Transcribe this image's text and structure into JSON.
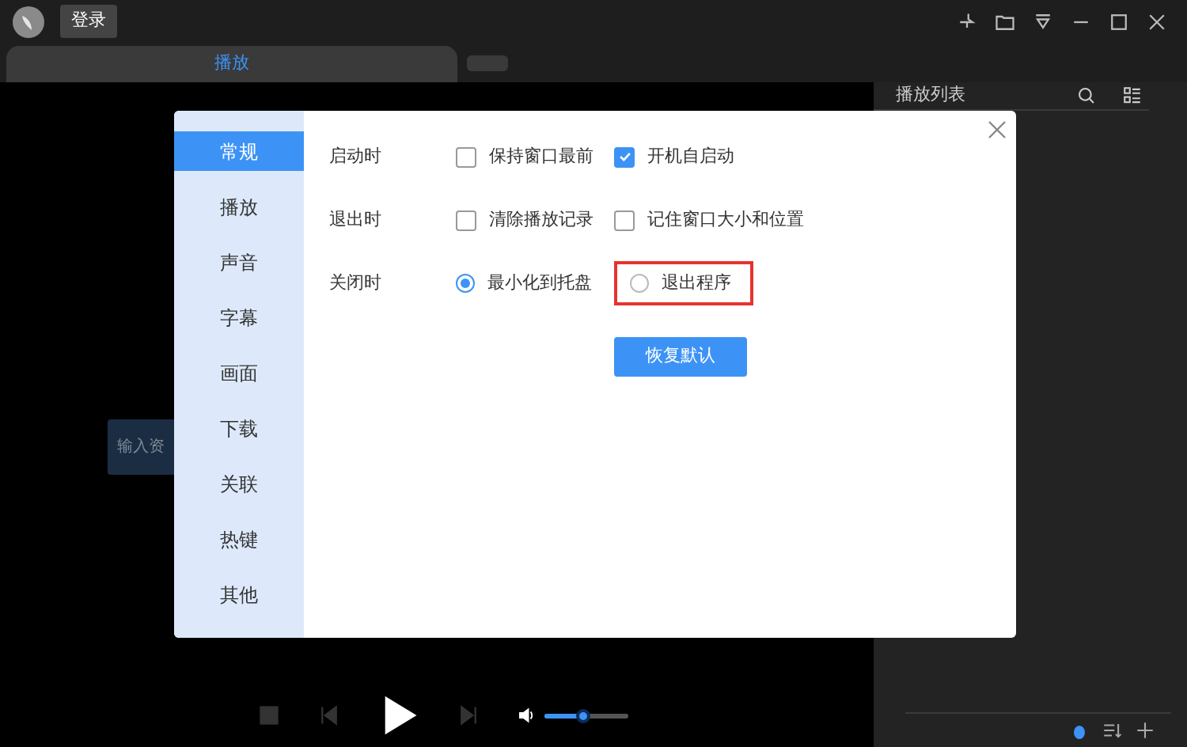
{
  "titlebar": {
    "login_button": "登录"
  },
  "tabs": [
    {
      "kind": "tab",
      "label": "播放",
      "selected": true
    },
    {
      "kind": "new",
      "selected": false
    }
  ],
  "playlist": {
    "title": "播放列表"
  },
  "video": {
    "input_hint": "输入资"
  },
  "player": {
    "volume": {
      "level": 0.45
    }
  },
  "settings": {
    "nav": [
      {
        "label": "常规",
        "selected": true
      },
      {
        "label": "播放",
        "selected": false
      },
      {
        "label": "声音",
        "selected": false
      },
      {
        "label": "字幕",
        "selected": false
      },
      {
        "label": "画面",
        "selected": false
      },
      {
        "label": "下载",
        "selected": false
      },
      {
        "label": "关联",
        "selected": false
      },
      {
        "label": "热键",
        "selected": false
      },
      {
        "label": "其他",
        "selected": false
      }
    ],
    "rows": [
      {
        "label": "启动时",
        "kind": "checkbox",
        "options": [
          {
            "label": "保持窗口最前",
            "checked": false
          },
          {
            "label": "开机自启动",
            "checked": true
          }
        ]
      },
      {
        "label": "退出时",
        "kind": "checkbox",
        "options": [
          {
            "label": "清除播放记录",
            "checked": false
          },
          {
            "label": "记住窗口大小和位置",
            "checked": false
          }
        ]
      },
      {
        "label": "关闭时",
        "kind": "radio",
        "options": [
          {
            "label": "最小化到托盘",
            "selected": true,
            "highlighted": false
          },
          {
            "label": "退出程序",
            "selected": false,
            "highlighted": true
          }
        ]
      }
    ],
    "reset_button": "恢复默认"
  }
}
